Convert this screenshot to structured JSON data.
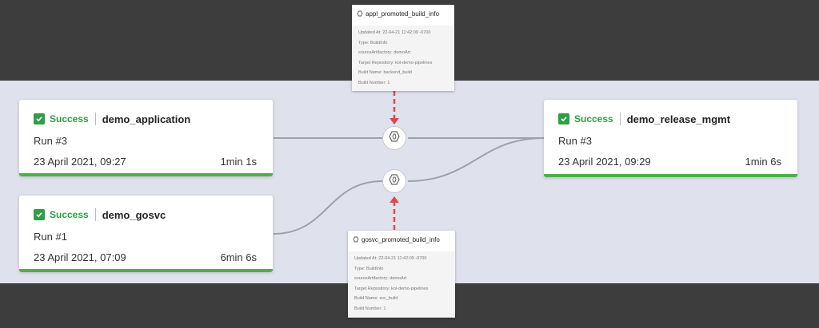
{
  "colors": {
    "success": "#2f9e44",
    "bar": "#4db14b",
    "link": "#9ea1ad",
    "arrow": "#e0474c",
    "band": "#dfe1ec",
    "background": "#3d3d3d"
  },
  "pipelines": [
    {
      "status": "Success",
      "name": "demo_application",
      "run": "Run #3",
      "date": "23 April 2021, 09:27",
      "duration": "1min 1s"
    },
    {
      "status": "Success",
      "name": "demo_gosvc",
      "run": "Run #1",
      "date": "23 April 2021, 07:09",
      "duration": "6min 6s"
    },
    {
      "status": "Success",
      "name": "demo_release_mgmt",
      "run": "Run #3",
      "date": "23 April 2021, 09:29",
      "duration": "1min 6s"
    }
  ],
  "resources": [
    {
      "icon": "build-info-icon",
      "title": "appl_promoted_build_info",
      "lines": [
        "Updated At: 22-04-21 11:42:09 -0700",
        "Type: BuildInfo",
        "sourceArtifactory: demoArt",
        "Target Repository: kol-demo-pipelines",
        "Build Name: backend_build",
        "Build Number: 1"
      ]
    },
    {
      "icon": "build-info-icon",
      "title": "gosvc_promoted_build_info",
      "lines": [
        "Updated At: 22-04-21 11:42:09 -0700",
        "Type: BuildInfo",
        "sourceArtifactory: demoArt",
        "Target Repository: kol-demo-pipelines",
        "Build Name: svc_build",
        "Build Number: 1"
      ]
    }
  ]
}
